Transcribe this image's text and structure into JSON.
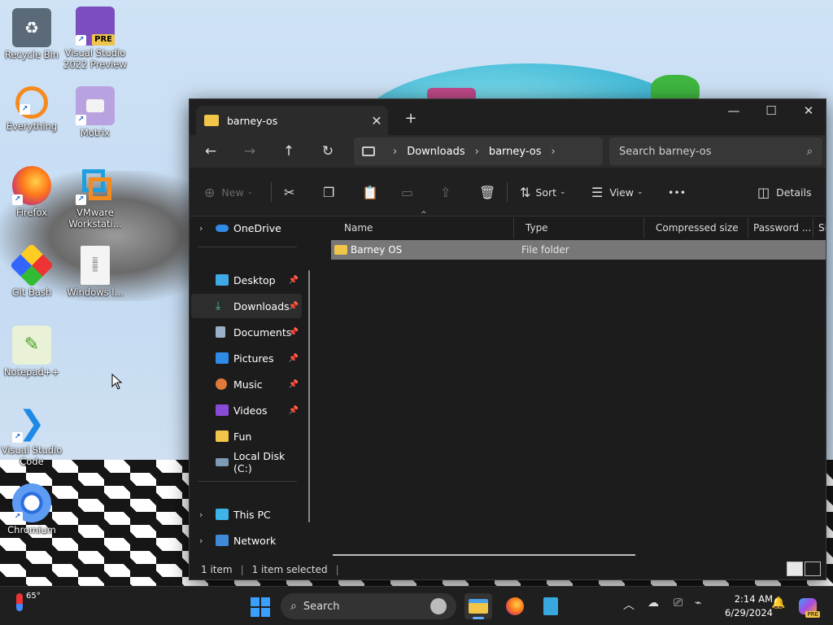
{
  "desktop": {
    "icons": [
      {
        "label": "Recycle Bin"
      },
      {
        "label": "Visual Studio 2022 Preview",
        "badge": "PRE"
      },
      {
        "label": "Everything"
      },
      {
        "label": "Motrix"
      },
      {
        "label": "Firefox"
      },
      {
        "label": "VMware Workstati..."
      },
      {
        "label": "Git Bash"
      },
      {
        "label": "Windows I..."
      },
      {
        "label": "Notepad++"
      },
      {
        "label": "Visual Studio Code"
      },
      {
        "label": "Chromium"
      }
    ]
  },
  "explorer": {
    "tab_title": "barney-os",
    "breadcrumbs": [
      "Downloads",
      "barney-os"
    ],
    "search_placeholder": "Search barney-os",
    "toolbar": {
      "new_label": "New",
      "sort_label": "Sort",
      "view_label": "View",
      "more_label": "•••",
      "details_label": "Details"
    },
    "sidebar": {
      "onedrive": "OneDrive",
      "quick_access": [
        {
          "label": "Desktop"
        },
        {
          "label": "Downloads"
        },
        {
          "label": "Documents"
        },
        {
          "label": "Pictures"
        },
        {
          "label": "Music"
        },
        {
          "label": "Videos"
        },
        {
          "label": "Fun"
        },
        {
          "label": "Local Disk (C:)"
        }
      ],
      "this_pc": "This PC",
      "network": "Network"
    },
    "columns": [
      "Name",
      "Type",
      "Compressed size",
      "Password ...",
      "Si"
    ],
    "rows": [
      {
        "name": "Barney OS",
        "type": "File folder"
      }
    ],
    "status": {
      "count": "1 item",
      "selected": "1 item selected"
    }
  },
  "taskbar": {
    "weather_temp": "65°",
    "search_label": "Search",
    "time": "2:14 AM",
    "date": "6/29/2024",
    "copilot_badge": "PRE"
  },
  "colors": {
    "folder": "#f1c44a",
    "accent": "#3aa0ff",
    "window_bg": "#1c1c1c"
  }
}
